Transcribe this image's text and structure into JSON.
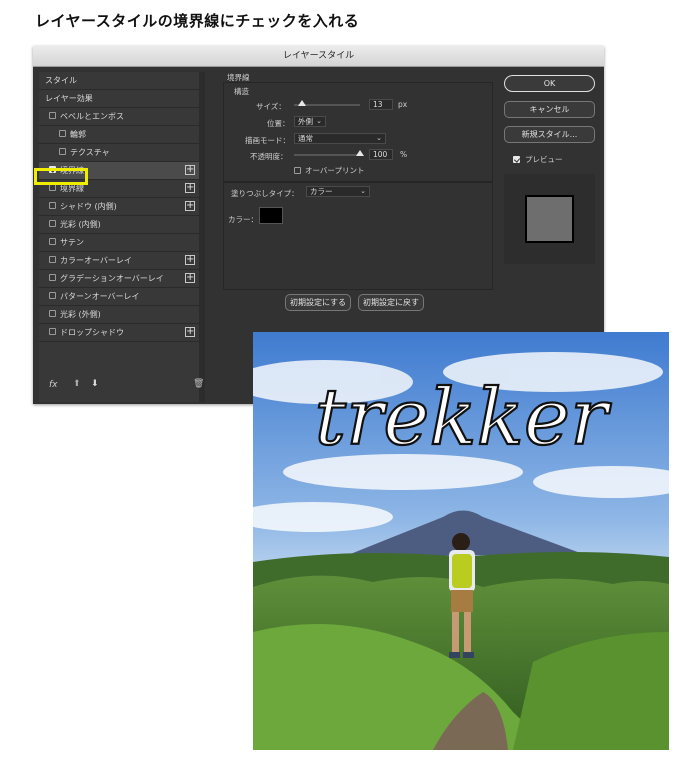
{
  "heading": "レイヤースタイルの境界線にチェックを入れる",
  "dialog": {
    "title": "レイヤースタイル",
    "left_panel": {
      "style_label": "スタイル",
      "effects_label": "レイヤー効果",
      "items": [
        {
          "label": "ベベルとエンボス",
          "checked": false,
          "plus": false
        },
        {
          "label": "輪郭",
          "checked": false,
          "plus": false
        },
        {
          "label": "テクスチャ",
          "checked": false,
          "plus": false
        },
        {
          "label": "境界線",
          "checked": true,
          "plus": true
        },
        {
          "label": "境界線",
          "checked": false,
          "plus": true
        },
        {
          "label": "シャドウ (内側)",
          "checked": false,
          "plus": true
        },
        {
          "label": "光彩 (内側)",
          "checked": false,
          "plus": false
        },
        {
          "label": "サテン",
          "checked": false,
          "plus": false
        },
        {
          "label": "カラーオーバーレイ",
          "checked": false,
          "plus": true
        },
        {
          "label": "グラデーションオーバーレイ",
          "checked": false,
          "plus": true
        },
        {
          "label": "パターンオーバーレイ",
          "checked": false,
          "plus": false
        },
        {
          "label": "光彩 (外側)",
          "checked": false,
          "plus": false
        },
        {
          "label": "ドロップシャドウ",
          "checked": false,
          "plus": true
        }
      ],
      "footer_fx": "fx",
      "up_icon": "arrow-up-icon",
      "down_icon": "arrow-down-icon",
      "trash_icon": "trash-icon"
    },
    "stroke": {
      "section_title": "境界線",
      "structure_title": "構造",
      "size_label": "サイズ：",
      "size_value": "13",
      "size_unit": "px",
      "size_level": 0.12,
      "position_label": "位置：",
      "position_value": "外側",
      "blend_label": "描画モード：",
      "blend_value": "通常",
      "opacity_label": "不透明度：",
      "opacity_value": "100",
      "opacity_unit": "%",
      "opacity_level": 1.0,
      "overprint_label": "オーバープリント",
      "fill_type_label": "塗りつぶしタイプ：",
      "fill_type_value": "カラー",
      "color_label": "カラー：",
      "color_hex": "#000000",
      "reset_default_btn": "初期設定にする",
      "restore_default_btn": "初期設定に戻す"
    },
    "right": {
      "ok": "OK",
      "cancel": "キャンセル",
      "new_style": "新規スタイル...",
      "preview_label": "プレビュー",
      "preview_checked": true
    }
  },
  "photo": {
    "overlay_text": "trekker"
  }
}
